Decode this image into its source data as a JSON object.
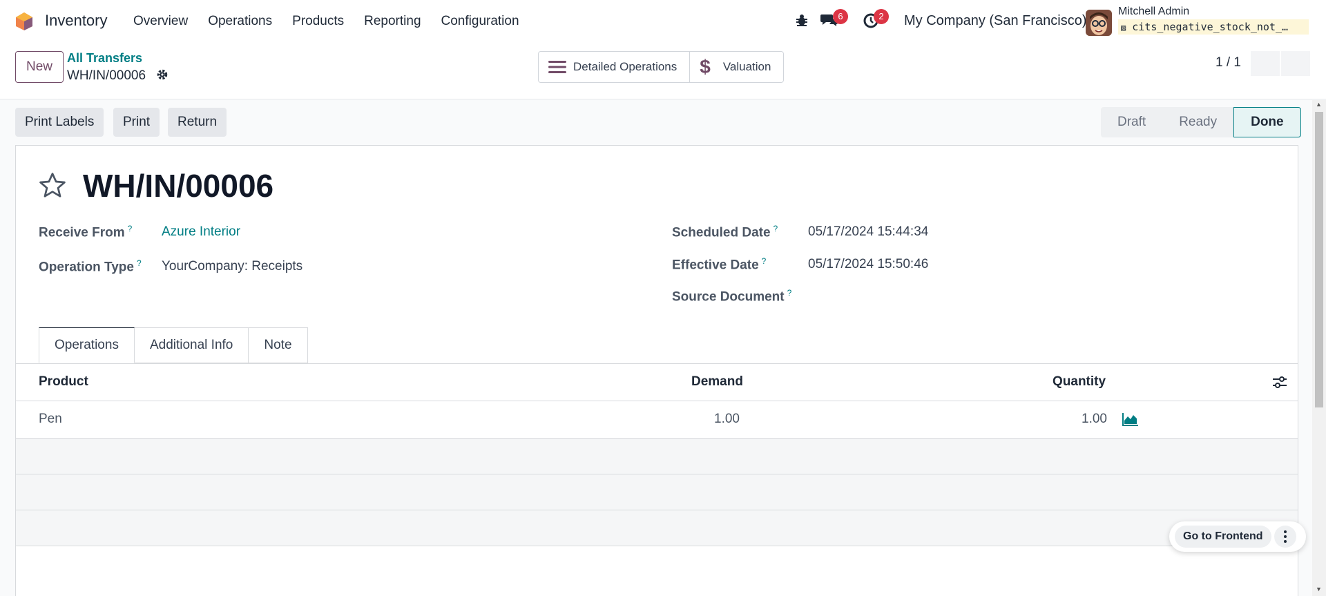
{
  "navbar": {
    "app_name": "Inventory",
    "menu": [
      "Overview",
      "Operations",
      "Products",
      "Reporting",
      "Configuration"
    ],
    "messages_count": "6",
    "activities_count": "2",
    "company": "My Company (San Francisco)",
    "user_name": "Mitchell Admin",
    "database": "cits_negative_stock_not_…"
  },
  "control_panel": {
    "new_label": "New",
    "breadcrumb": "All Transfers",
    "record_name": "WH/IN/00006",
    "smart_buttons": [
      "Detailed Operations",
      "Valuation"
    ],
    "pager": "1 / 1"
  },
  "actions": [
    "Print Labels",
    "Print",
    "Return"
  ],
  "status_stages": [
    "Draft",
    "Ready",
    "Done"
  ],
  "active_stage": "Done",
  "form": {
    "title": "WH/IN/00006",
    "receive_from_label": "Receive From",
    "receive_from_value": "Azure Interior",
    "operation_type_label": "Operation Type",
    "operation_type_value": "YourCompany: Receipts",
    "scheduled_date_label": "Scheduled Date",
    "scheduled_date_value": "05/17/2024 15:44:34",
    "effective_date_label": "Effective Date",
    "effective_date_value": "05/17/2024 15:50:46",
    "source_document_label": "Source Document",
    "help_mark": "?"
  },
  "tabs": [
    "Operations",
    "Additional Info",
    "Note"
  ],
  "table": {
    "columns": [
      "Product",
      "Demand",
      "Quantity"
    ],
    "rows": [
      {
        "product": "Pen",
        "demand": "1.00",
        "quantity": "1.00"
      }
    ]
  },
  "floating": {
    "frontend_label": "Go to Frontend"
  },
  "colors": {
    "brand": "#714b67",
    "accent": "#017e84",
    "badge": "#dc3545"
  }
}
